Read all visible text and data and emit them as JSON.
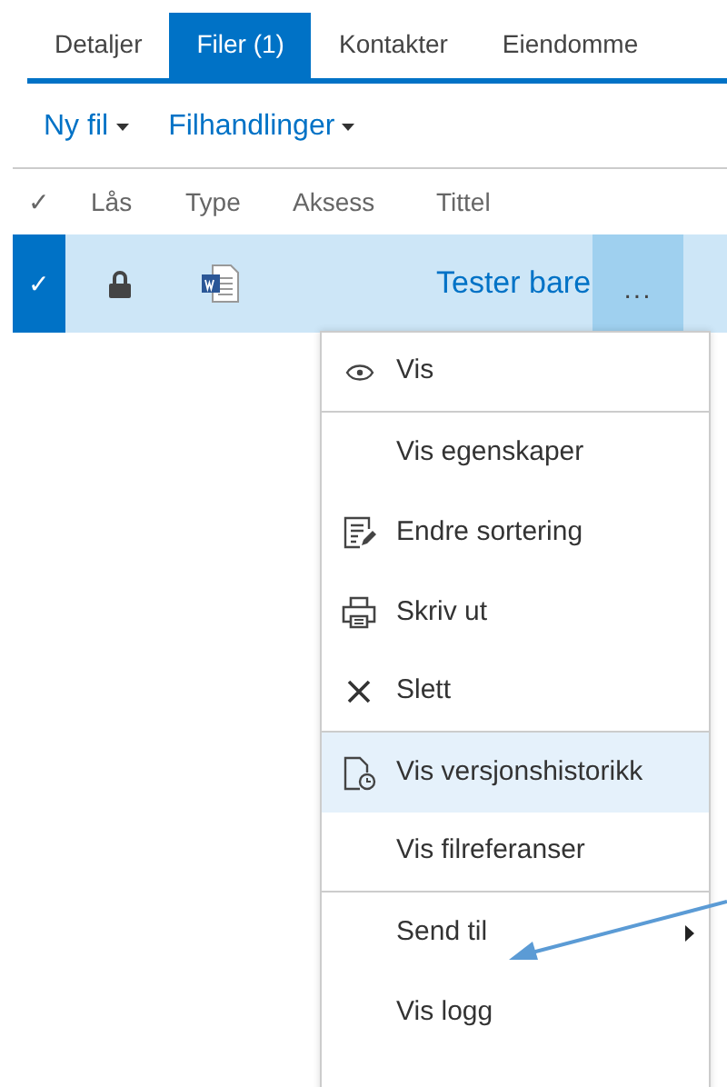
{
  "tabs": [
    {
      "label": "Detaljer",
      "selected": false
    },
    {
      "label": "Filer (1)",
      "selected": true
    },
    {
      "label": "Kontakter",
      "selected": false
    },
    {
      "label": "Eiendomme",
      "selected": false
    }
  ],
  "toolbar": [
    {
      "label": "Ny fil"
    },
    {
      "label": "Filhandlinger"
    }
  ],
  "table": {
    "check_header": "✓",
    "columns": [
      "Lås",
      "Type",
      "Aksess",
      "Tittel"
    ],
    "rows": [
      {
        "selected": true,
        "locked": true,
        "title": "Tester bare",
        "more": "..."
      }
    ]
  },
  "context_menu": [
    {
      "label": "Vis",
      "highlighted": false,
      "submenu": false,
      "separator_after": true
    },
    {
      "label": "Vis egenskaper",
      "highlighted": false,
      "submenu": false,
      "separator_after": false
    },
    {
      "label": "Endre sortering",
      "highlighted": false,
      "submenu": false,
      "separator_after": false
    },
    {
      "label": "Skriv ut",
      "highlighted": false,
      "submenu": false,
      "separator_after": false
    },
    {
      "label": "Slett",
      "highlighted": false,
      "submenu": false,
      "separator_after": true
    },
    {
      "label": "Vis versjonshistorikk",
      "highlighted": true,
      "submenu": false,
      "separator_after": false
    },
    {
      "label": "Vis filreferanser",
      "highlighted": false,
      "submenu": false,
      "separator_after": true
    },
    {
      "label": "Send til",
      "highlighted": false,
      "submenu": true,
      "separator_after": false
    },
    {
      "label": "Vis logg",
      "highlighted": false,
      "submenu": false,
      "separator_after": false
    }
  ]
}
